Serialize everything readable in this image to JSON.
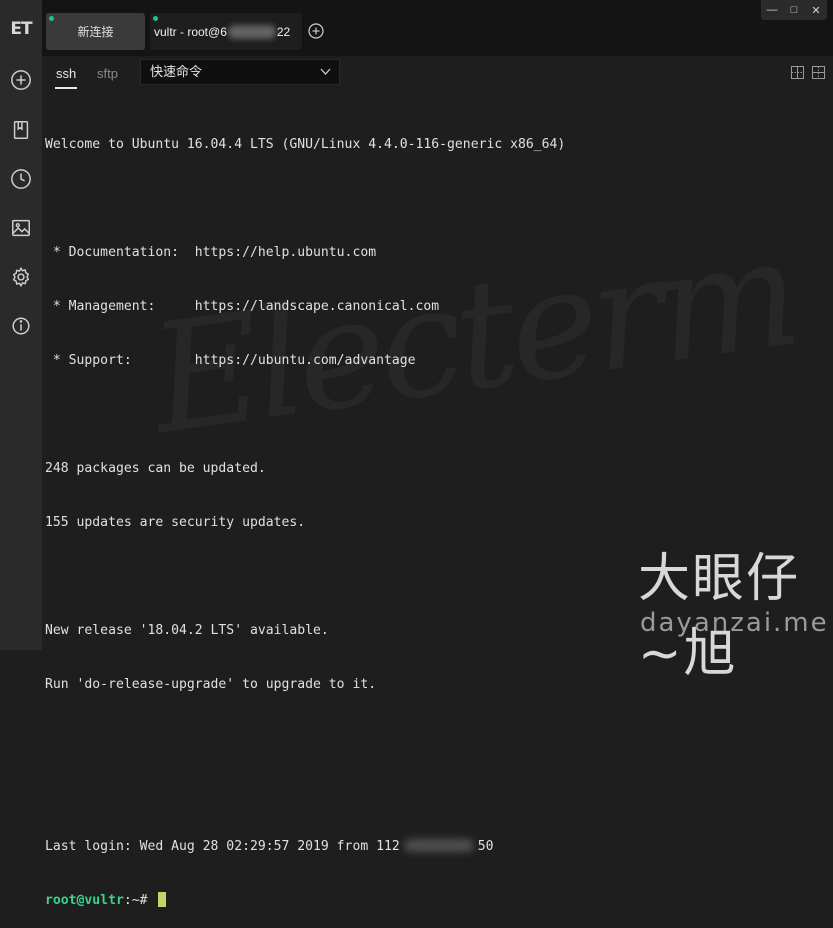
{
  "app": {
    "logo_text": "ET"
  },
  "window_controls": {
    "minimize": "—",
    "maximize": "□",
    "close": "✕"
  },
  "tabs": [
    {
      "label": "新连接"
    },
    {
      "label_prefix": "vultr - root@6",
      "label_suffix": "22"
    }
  ],
  "subtabs": {
    "ssh": "ssh",
    "sftp": "sftp"
  },
  "quick_command": {
    "label": "快速命令"
  },
  "sidebar": {
    "items": [
      {
        "icon": "plus-circle-icon"
      },
      {
        "icon": "bookmark-icon"
      },
      {
        "icon": "history-clock-icon"
      },
      {
        "icon": "image-icon"
      },
      {
        "icon": "gear-icon"
      },
      {
        "icon": "info-icon"
      }
    ]
  },
  "terminal": {
    "lines": [
      "Welcome to Ubuntu 16.04.4 LTS (GNU/Linux 4.4.0-116-generic x86_64)",
      "",
      " * Documentation:  https://help.ubuntu.com",
      " * Management:     https://landscape.canonical.com",
      " * Support:        https://ubuntu.com/advantage",
      "",
      "248 packages can be updated.",
      "155 updates are security updates.",
      "",
      "New release '18.04.2 LTS' available.",
      "Run 'do-release-upgrade' to upgrade to it.",
      "",
      ""
    ],
    "last_login_prefix": "Last login: Wed Aug 28 02:29:57 2019 from 112",
    "last_login_suffix": "50",
    "prompt_user": "root@vultr",
    "prompt_path": ":~# "
  },
  "background_mark": "Electerm",
  "watermark": {
    "title": "大眼仔~旭",
    "url": "dayanzai.me"
  },
  "colors": {
    "accent_green": "#36d48e",
    "cursor": "#c8d26a",
    "active_dot": "#27c07d"
  }
}
